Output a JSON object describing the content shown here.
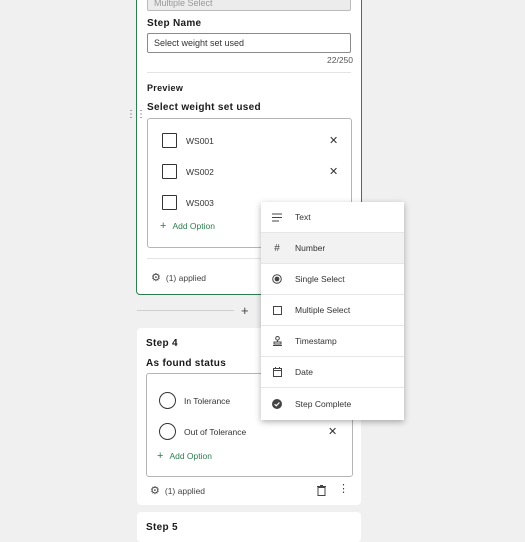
{
  "step3": {
    "type_select_value": "Multiple Select",
    "step_name_label": "Step Name",
    "step_name_value": "Select weight set used",
    "char_count": "22/250",
    "preview_label": "Preview",
    "preview_question": "Select weight set used",
    "options": [
      "WS001",
      "WS002",
      "WS003"
    ],
    "add_option": "Add Option",
    "applied": "(1) applied"
  },
  "step4": {
    "title": "Step 4",
    "question": "As found status",
    "options": [
      "In Tolerance",
      "Out of Tolerance"
    ],
    "add_option": "Add Option",
    "applied": "(1) applied"
  },
  "step5": {
    "title": "Step 5"
  },
  "menu": {
    "items": [
      {
        "label": "Text",
        "icon": "text-lines-icon"
      },
      {
        "label": "Number",
        "icon": "hash-icon"
      },
      {
        "label": "Single Select",
        "icon": "radio-icon"
      },
      {
        "label": "Multiple Select",
        "icon": "checkbox-icon"
      },
      {
        "label": "Timestamp",
        "icon": "stamp-icon"
      },
      {
        "label": "Date",
        "icon": "calendar-icon"
      },
      {
        "label": "Step Complete",
        "icon": "check-circle-icon"
      }
    ]
  },
  "colors": {
    "accent": "#2e7d4f",
    "background": "#f0f0f1"
  }
}
